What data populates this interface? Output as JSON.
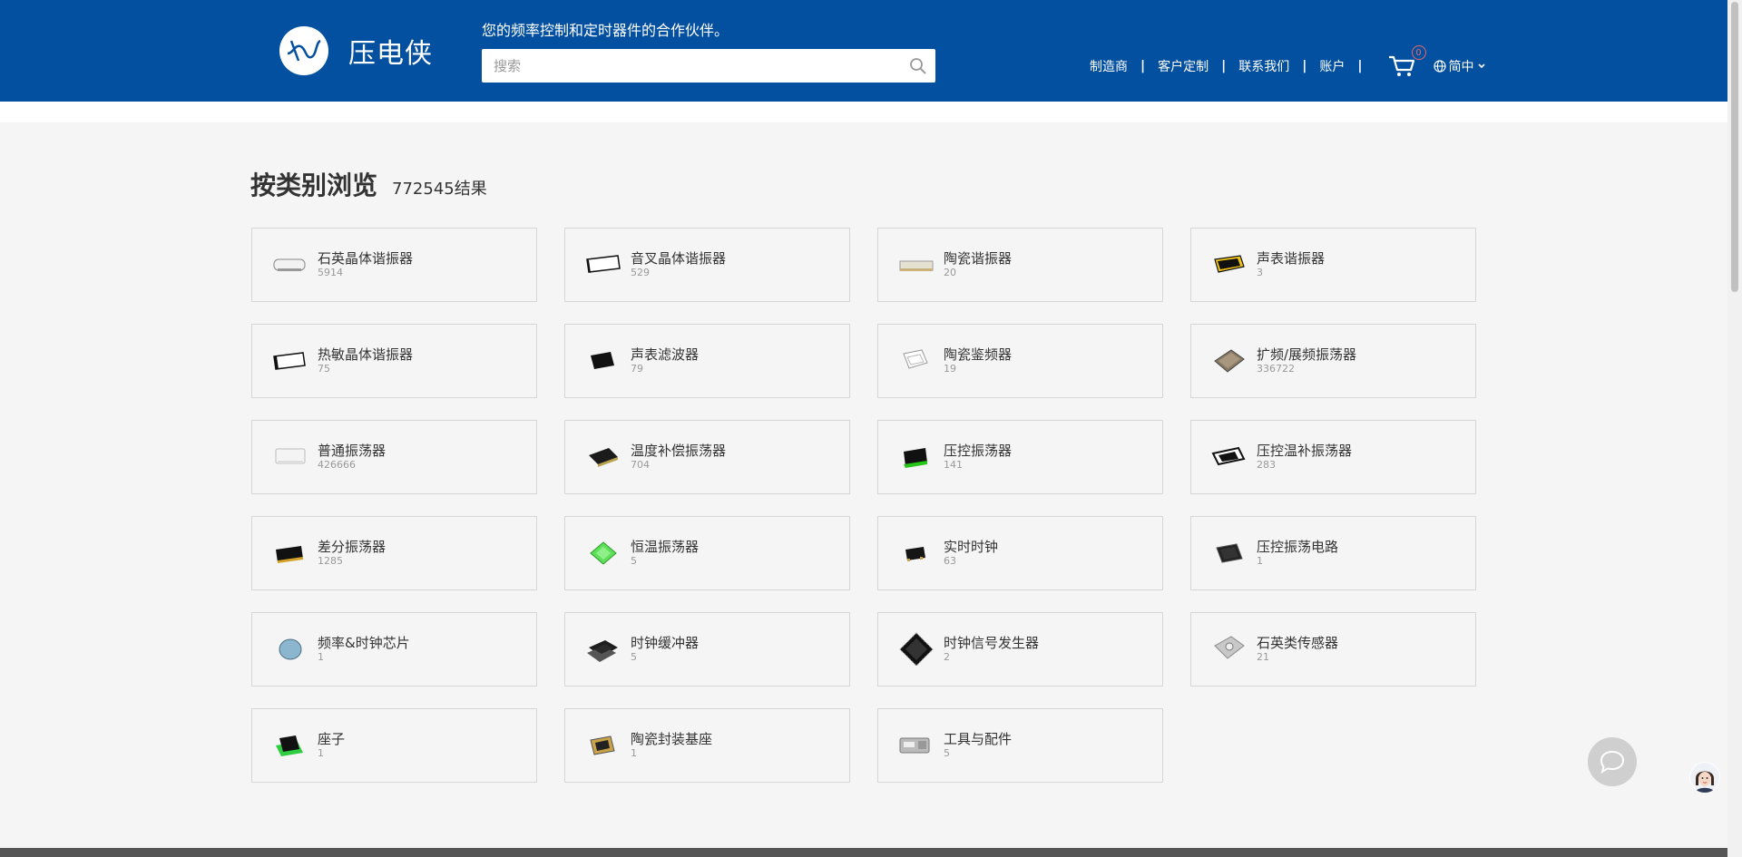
{
  "header": {
    "logo_text": "压电侠",
    "tagline": "您的频率控制和定时器件的合作伙伴。",
    "search": {
      "placeholder": "搜索",
      "value": ""
    },
    "nav": [
      {
        "label": "制造商"
      },
      {
        "label": "客户定制"
      },
      {
        "label": "联系我们"
      },
      {
        "label": "账户"
      }
    ],
    "cart_count": "0",
    "language": "简中"
  },
  "main": {
    "title": "按类别浏览",
    "result_count": "772545结果",
    "categories": [
      {
        "name": "石英晶体谐振器",
        "count": "5914",
        "icon": "quartz-crystal-icon"
      },
      {
        "name": "音叉晶体谐振器",
        "count": "529",
        "icon": "tuning-fork-crystal-icon"
      },
      {
        "name": "陶瓷谐振器",
        "count": "20",
        "icon": "ceramic-resonator-icon"
      },
      {
        "name": "声表谐振器",
        "count": "3",
        "icon": "saw-resonator-icon"
      },
      {
        "name": "热敏晶体谐振器",
        "count": "75",
        "icon": "thermistor-crystal-icon"
      },
      {
        "name": "声表滤波器",
        "count": "79",
        "icon": "saw-filter-icon"
      },
      {
        "name": "陶瓷鉴频器",
        "count": "19",
        "icon": "ceramic-discriminator-icon"
      },
      {
        "name": "扩频/展频振荡器",
        "count": "336722",
        "icon": "spread-spectrum-oscillator-icon"
      },
      {
        "name": "普通振荡器",
        "count": "426666",
        "icon": "oscillator-icon"
      },
      {
        "name": "温度补偿振荡器",
        "count": "704",
        "icon": "tcxo-icon"
      },
      {
        "name": "压控振荡器",
        "count": "141",
        "icon": "vcxo-icon"
      },
      {
        "name": "压控温补振荡器",
        "count": "283",
        "icon": "vctcxo-icon"
      },
      {
        "name": "差分振荡器",
        "count": "1285",
        "icon": "differential-oscillator-icon"
      },
      {
        "name": "恒温振荡器",
        "count": "5",
        "icon": "ocxo-icon"
      },
      {
        "name": "实时时钟",
        "count": "63",
        "icon": "rtc-icon"
      },
      {
        "name": "压控振荡电路",
        "count": "1",
        "icon": "vco-circuit-icon"
      },
      {
        "name": "频率&时钟芯片",
        "count": "1",
        "icon": "clock-chip-icon"
      },
      {
        "name": "时钟缓冲器",
        "count": "5",
        "icon": "clock-buffer-icon"
      },
      {
        "name": "时钟信号发生器",
        "count": "2",
        "icon": "clock-generator-icon"
      },
      {
        "name": "石英类传感器",
        "count": "21",
        "icon": "quartz-sensor-icon"
      },
      {
        "name": "座子",
        "count": "1",
        "icon": "socket-icon"
      },
      {
        "name": "陶瓷封装基座",
        "count": "1",
        "icon": "ceramic-package-icon"
      },
      {
        "name": "工具与配件",
        "count": "5",
        "icon": "tools-icon"
      }
    ]
  },
  "colors": {
    "header_bg": "#02509f",
    "page_bg": "#f5f5f5",
    "card_border": "#d6d6d6",
    "badge": "#e46a6a"
  }
}
